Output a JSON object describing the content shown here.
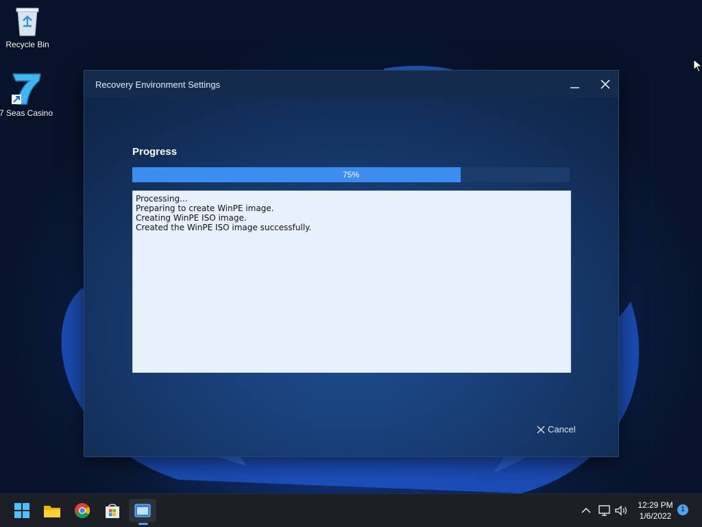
{
  "desktop": {
    "icons": [
      {
        "label": "Recycle Bin",
        "icon": "recycle-bin-icon"
      },
      {
        "label": "7 Seas Casino",
        "icon": "seven-seas-casino-icon"
      }
    ]
  },
  "window": {
    "title": "Recovery Environment Settings",
    "progress_heading": "Progress",
    "progress_value": 0.75,
    "progress_label": "75%",
    "log_lines": [
      "Processing...",
      "Preparing to create WinPE image.",
      "Creating WinPE ISO image.",
      "Created the WinPE ISO image successfully."
    ],
    "cancel_label": "Cancel"
  },
  "taskbar": {
    "apps": [
      "start-icon",
      "file-explorer-icon",
      "chrome-icon",
      "store-icon",
      "recovery-app-icon"
    ],
    "time": "12:29 PM",
    "date": "1/6/2022",
    "notification_count": "1"
  },
  "colors": {
    "accent": "#3b8ef0",
    "progress_track": "#1c3d6c",
    "log_background": "#e7f0fb",
    "taskbar": "#1c1f26"
  }
}
